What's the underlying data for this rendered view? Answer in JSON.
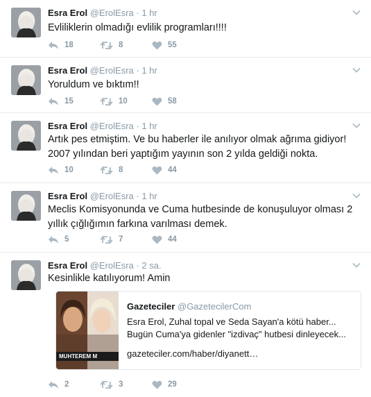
{
  "author": {
    "name": "Esra Erol",
    "handle": "@ErolEsra"
  },
  "tweets": [
    {
      "time": "1 hr",
      "text": "Evliliklerin olmadığı evlilik programları!!!!",
      "replies": "18",
      "retweets": "8",
      "likes": "55"
    },
    {
      "time": "1 hr",
      "text": "Yoruldum ve bıktım!!",
      "replies": "15",
      "retweets": "10",
      "likes": "58"
    },
    {
      "time": "1 hr",
      "text": "Artık pes etmiştim. Ve bu haberler ile anılıyor olmak ağrıma gidiyor! 2007 yılından beri yaptığım yayının son 2 yılda geldiği nokta.",
      "replies": "10",
      "retweets": "8",
      "likes": "44"
    },
    {
      "time": "1 hr",
      "text": "Meclis Komisyonunda ve Cuma hutbesinde de konuşuluyor  olması 2 yıllık çığlığımın farkına varılması demek.",
      "replies": "5",
      "retweets": "7",
      "likes": "44"
    },
    {
      "time": "2 sa.",
      "text": "Kesinlikle katılıyorum! Amin",
      "replies": "2",
      "retweets": "3",
      "likes": "29"
    }
  ],
  "quoted": {
    "name": "Gazeteciler",
    "handle": "@GazetecilerCom",
    "line1": "Esra Erol, Zuhal topal ve Seda Sayan'a kötü haber...",
    "line2": "Bugün Cuma'ya gidenler \"izdivaç\" hutbesi dinleyecek...",
    "url": "gazeteciler.com/haber/diyanett…",
    "image_caption": "MUHTEREM M"
  },
  "icons": {
    "reply": "reply-icon",
    "retweet": "retweet-icon",
    "like": "heart-icon",
    "menu": "chevron-down-icon"
  },
  "colors": {
    "muted": "#8899a6",
    "text": "#14171a",
    "divider": "#e6ecf0"
  }
}
